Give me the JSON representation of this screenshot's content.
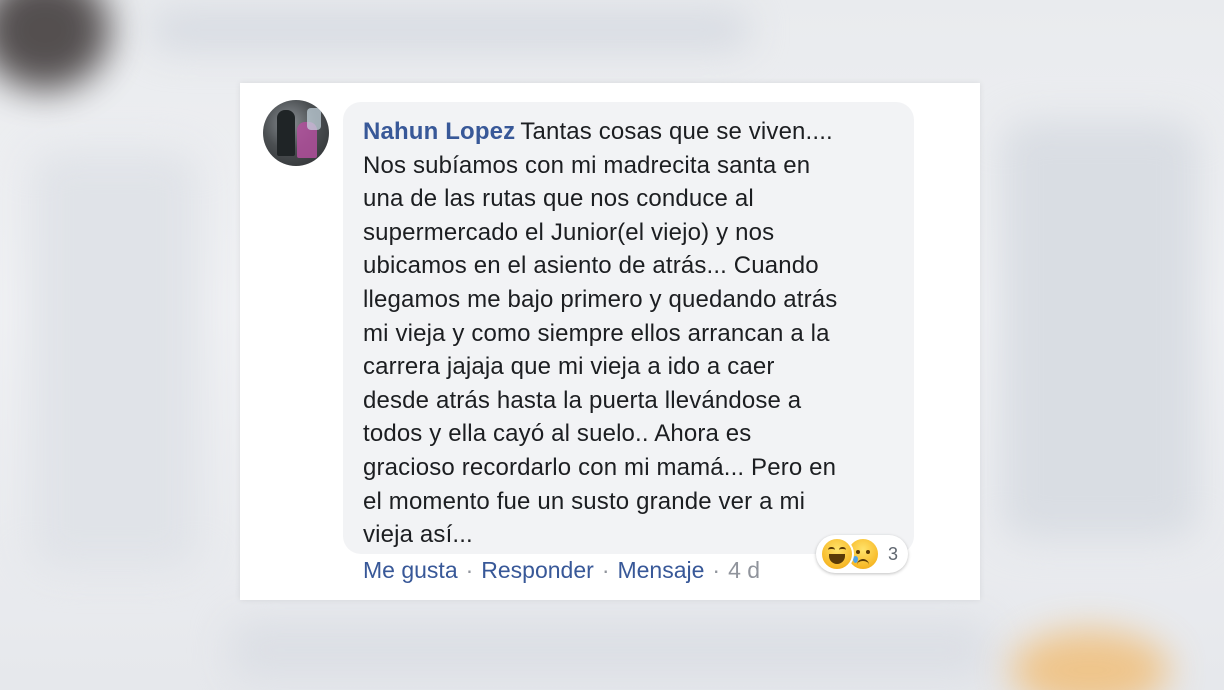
{
  "comment": {
    "author": "Nahun Lopez",
    "lines": [
      "Tantas cosas que se viven....",
      "Nos subíamos con mi madrecita santa en",
      "una de las rutas que nos conduce al",
      "supermercado el Junior(el viejo) y nos",
      "ubicamos en el asiento de atrás... Cuando",
      "llegamos me bajo primero y quedando atrás",
      "mi vieja y como siempre ellos arrancan a la",
      "carrera jajaja que mi vieja a ido a caer",
      "desde atrás hasta la puerta llevándose a",
      "todos y ella cayó al suelo.. Ahora es",
      "gracioso recordarlo con mi mamá... Pero en",
      "el momento fue un susto grande ver a mi",
      "vieja así..."
    ]
  },
  "reactions": {
    "icons": [
      "haha-icon",
      "sad-icon"
    ],
    "count": "3"
  },
  "actions": {
    "like": "Me gusta",
    "reply": "Responder",
    "message": "Mensaje",
    "separator": "·",
    "time": "4 d"
  },
  "colors": {
    "author": "#385898",
    "link": "#385898",
    "muted": "#90949c",
    "bubble": "#f2f3f5"
  }
}
